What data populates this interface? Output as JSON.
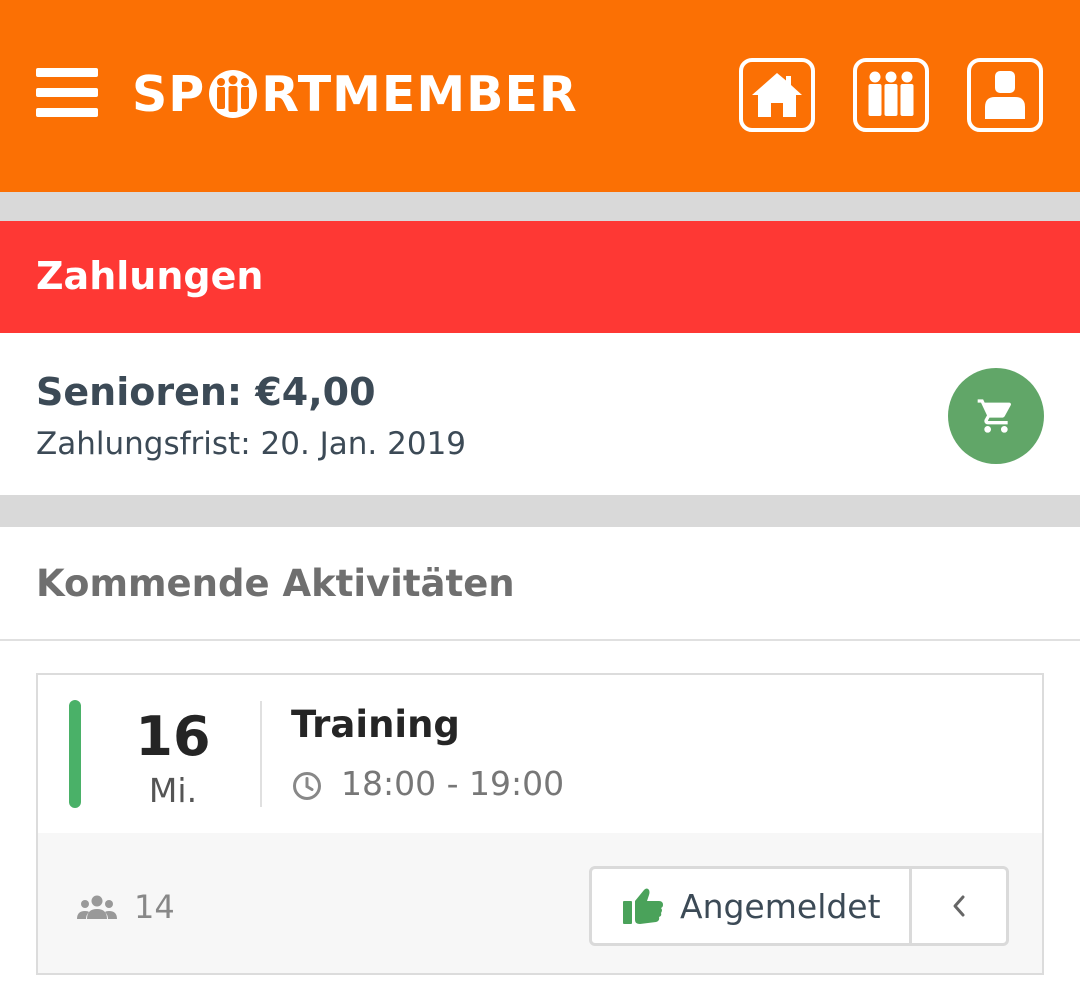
{
  "header": {
    "logo_text_left": "SP",
    "logo_text_right": "RTMEMBER",
    "icons": [
      "menu-icon",
      "home-icon",
      "team-icon",
      "user-icon"
    ],
    "brand_color": "#fb7004"
  },
  "payments": {
    "title": "Zahlungen",
    "item_name": "Senioren: €4,00",
    "deadline": "Zahlungsfrist: 20. Jan. 2019",
    "cart_icon": "cart-icon",
    "header_color": "#fe3834",
    "cart_color": "#61a668"
  },
  "upcoming": {
    "title": "Kommende Aktivitäten",
    "activities": [
      {
        "day": "16",
        "weekday": "Mi.",
        "title": "Training",
        "time": "18:00 - 19:00",
        "participants": "14",
        "status_label": "Angemeldet",
        "status_color": "#4ab168"
      }
    ]
  }
}
